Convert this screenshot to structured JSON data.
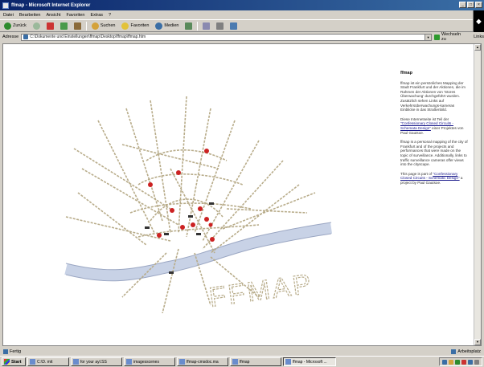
{
  "window": {
    "title": "ffmap - Microsoft Internet Explorer",
    "controls": [
      "_",
      "□",
      "×"
    ]
  },
  "menu": [
    "Datei",
    "Bearbeiten",
    "Ansicht",
    "Favoriten",
    "Extras",
    "?"
  ],
  "toolbar": {
    "back": "Zurück",
    "search": "Suchen",
    "favorites": "Favoriten",
    "media": "Medien"
  },
  "address": {
    "label": "Adresse",
    "url": "C:\\Dokumente und Einstellungen\\ffmap\\Desktop\\ffmap\\ffmap.htm",
    "go": "Wechseln zu",
    "links": "Links"
  },
  "colors": {
    "accent": "#0a246a",
    "river": "#c8d2e6",
    "street": "#b8ac8a",
    "marker": "#cc2222"
  },
  "map": {
    "logo_text": "FFMAP"
  },
  "side": {
    "title": "ffmap",
    "p1": "ffmap ist ein persönliches Mapping der Stadt Frankfurt und der Aktionen, die im Rahmen der Aktionen von 'Stores Überwachung' durchgeführt wurden. Zusätzlich sehen Links auf Verkehrsüberwachungs-kameras Einblicke in das Straßenbild.",
    "p2_pre": "Diese Internetseite ist Teil der ",
    "p2_link": "\"Confessionary Closed Circuits - Schemata Design\"",
    "p2_post": " einer Projektes von Paul Gautsoe.",
    "p3": "ffmap is a personal mapping of the city of Frankfurt and of the projects and performances that were made on the topic of surveillance. Additionally, links to traffic surveillance cameras offer views into the cityscape.",
    "p4_pre": "This page is part of ",
    "p4_link": "\"Confessionary Closed Circuits - Schematic Design\"",
    "p4_post": " a project by Paul Gautsoe."
  },
  "status": {
    "left": "Fertig",
    "right": "Arbeitsplatz"
  },
  "taskbar": {
    "start": "Start",
    "tasks": [
      "C:\\D. mit",
      "for your ayl.SS",
      "imagesscenes",
      "ffmap-cmsdoc.ma",
      "ffmap",
      "ffmap - Microsoft ..."
    ],
    "active_index": 5
  }
}
